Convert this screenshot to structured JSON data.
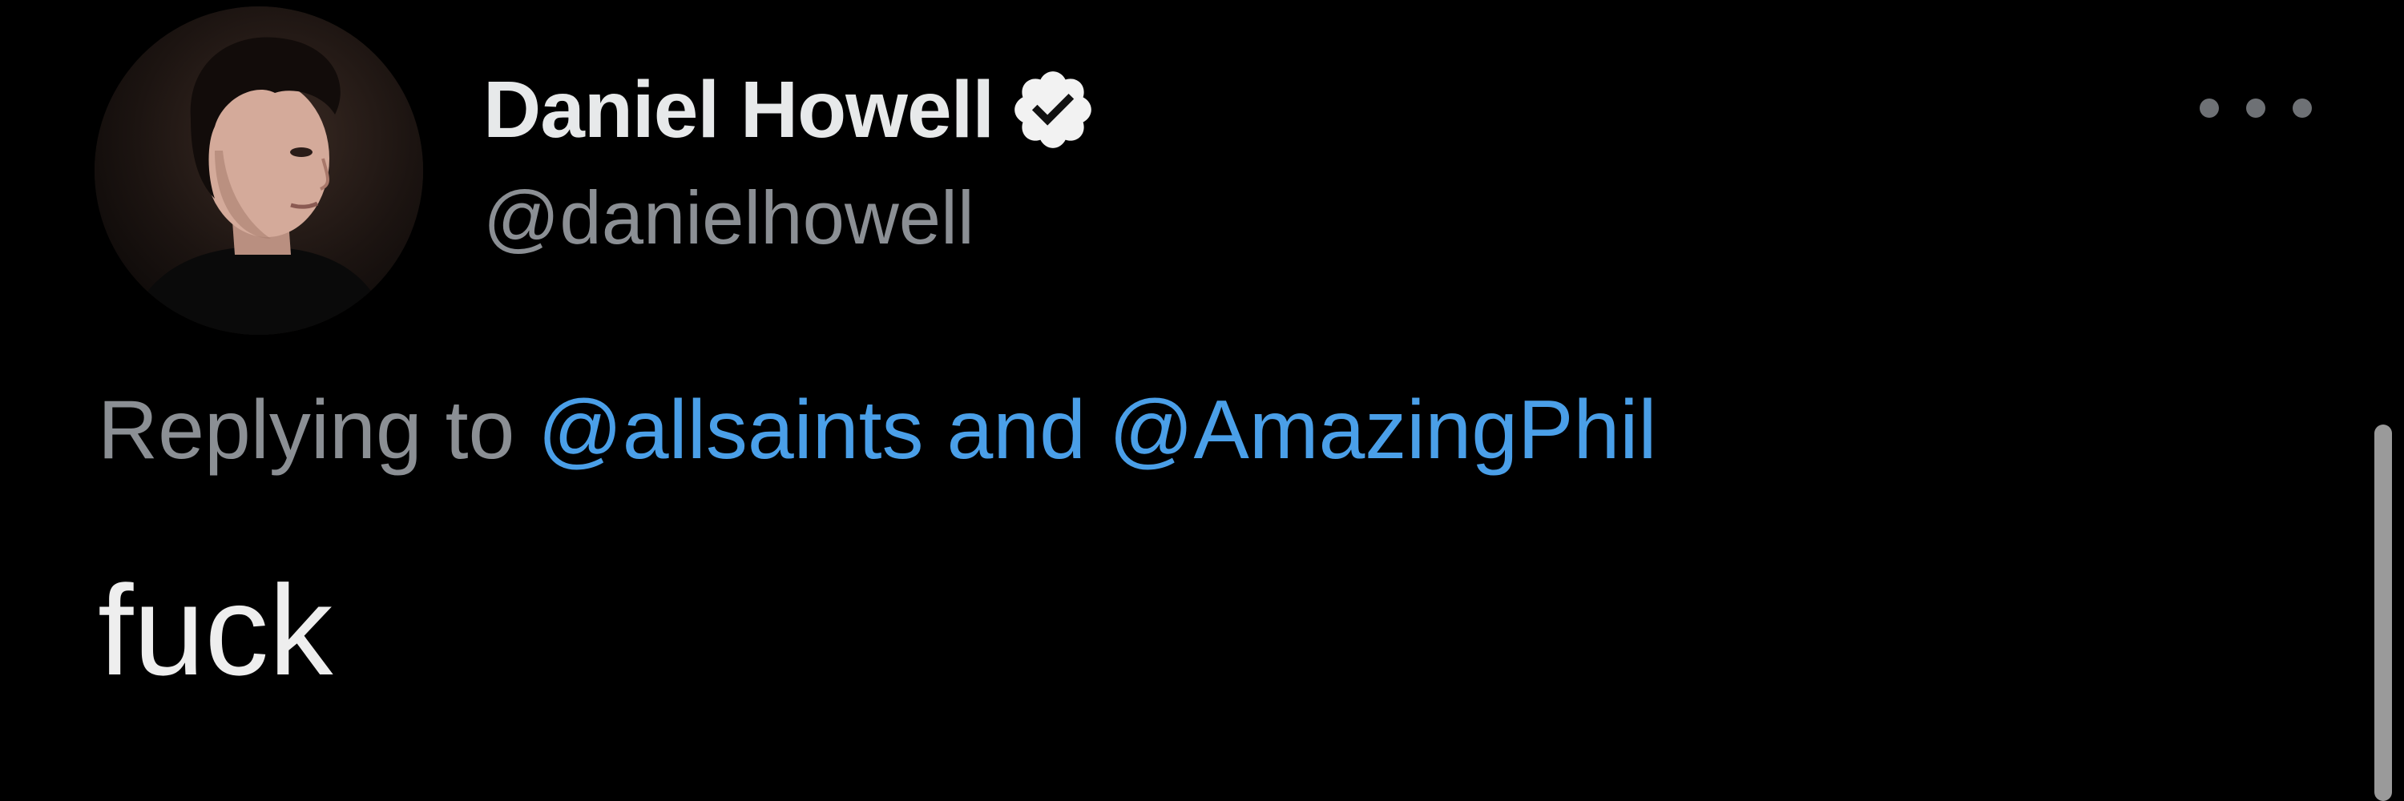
{
  "tweet": {
    "author": {
      "display_name": "Daniel Howell",
      "handle": "@danielhowell",
      "verified": true,
      "avatar_icon": "avatar-photo"
    },
    "more_icon": "more-horizontal-icon",
    "reply_context": {
      "prefix": "Replying to",
      "mentions": [
        "@allsaints",
        "@AmazingPhil"
      ],
      "separator": "and"
    },
    "text": "fuck"
  },
  "colors": {
    "background": "#000000",
    "name": "#e7e9ea",
    "secondary": "#8b8f94",
    "link": "#4a9fe8",
    "body_text": "#eeeeee"
  }
}
